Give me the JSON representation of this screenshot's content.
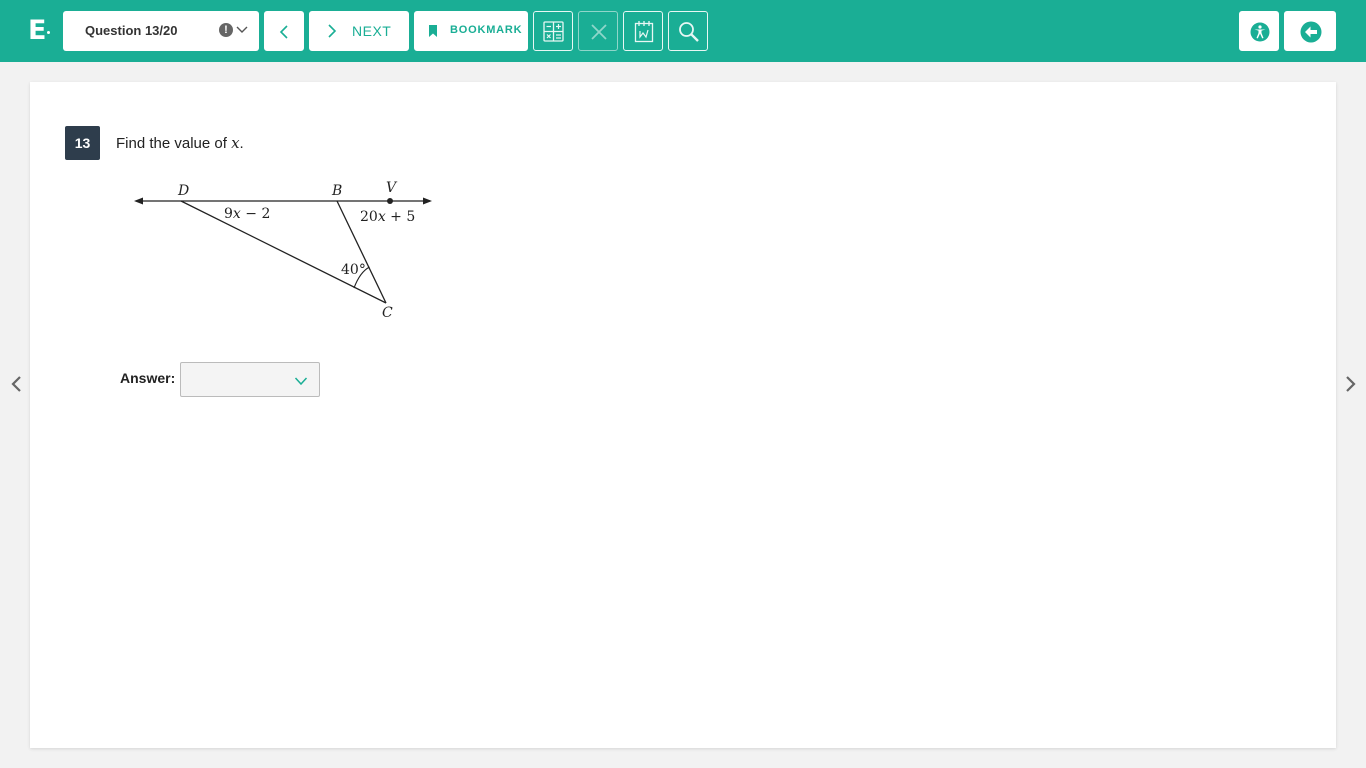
{
  "header": {
    "logo_letter": "E",
    "question_selector": "Question 13/20",
    "warn_symbol": "!",
    "next_label": "NEXT",
    "bookmark_label": "BOOKMARK"
  },
  "question": {
    "number": "13",
    "prompt": "Find the value of ",
    "variable": "x",
    "prompt_end": ".",
    "diagram": {
      "labels": {
        "D": "D",
        "B": "B",
        "V": "V",
        "C": "C"
      },
      "seg_dc": {
        "coef": "9",
        "var": "x",
        "rest": " − 2"
      },
      "angle_vbc": {
        "coef": "20",
        "var": "x",
        "rest": " + 5"
      },
      "angle_c": "40°"
    },
    "answer_label": "Answer:",
    "answer_value": ""
  },
  "colors": {
    "brand": "#1aae95",
    "qnum_bg": "#2e3d4c"
  }
}
